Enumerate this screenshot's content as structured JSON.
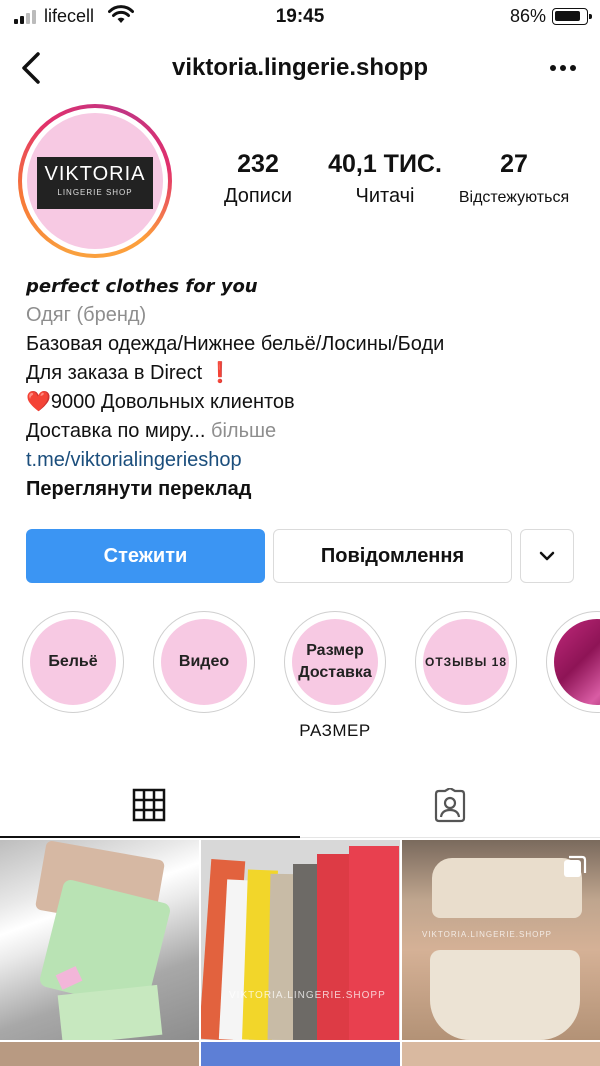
{
  "status_bar": {
    "carrier": "lifecell",
    "time": "19:45",
    "battery_percent": "86%",
    "battery_level": 0.86
  },
  "nav": {
    "username": "viktoria.lingerie.shopp",
    "back_icon": "chevron-left-icon",
    "more_icon": "more-horizontal-icon"
  },
  "profile": {
    "avatar_logo_line1": "VIKTORIA",
    "avatar_logo_line2": "LINGERIE SHOP",
    "stats": {
      "posts_count": "232",
      "posts_label": "Дописи",
      "followers_count": "40,1 ТИС.",
      "followers_label": "Читачі",
      "following_count": "27",
      "following_label": "Відстежуються"
    }
  },
  "bio": {
    "tagline": "perfect clothes for you",
    "category": "Одяг (бренд)",
    "line1": "Базовая одежда/Нижнее бельё/Лосины/Боди",
    "line2": "Для заказа в Direct",
    "line2_emoji": "❗",
    "line3_emoji": "❤️",
    "line3": "9000 Довольных клиентов",
    "line4": "Доставка по миру...",
    "more_label": "більше",
    "link": "t.me/viktorialingerieshop",
    "translate_label": "Переглянути переклад"
  },
  "buttons": {
    "follow": "Стежити",
    "message": "Повідомлення",
    "dropdown_icon": "chevron-down-icon"
  },
  "highlights": [
    {
      "title": "Бельё",
      "label": ""
    },
    {
      "title": "Видео",
      "label": ""
    },
    {
      "title_line1": "Размер",
      "title_line2": "Доставка",
      "label": "РАЗМЕР"
    },
    {
      "title": "ОТЗЫВЫ 18",
      "label": ""
    },
    {
      "title": "",
      "label": ""
    }
  ],
  "tabs": {
    "grid_icon": "grid-icon",
    "tagged_icon": "tagged-person-icon",
    "active": "grid"
  },
  "posts": [
    {
      "watermark": ""
    },
    {
      "watermark": "VIKTORIA.LINGERIE.SHOPP"
    },
    {
      "watermark": "VIKTORIA.LINGERIE.SHOPP",
      "multi_icon": "carousel-icon"
    }
  ],
  "colors": {
    "follow_button": "#3b95f3",
    "link": "#1b4e7c",
    "highlight_fill": "#f7c9e3"
  }
}
